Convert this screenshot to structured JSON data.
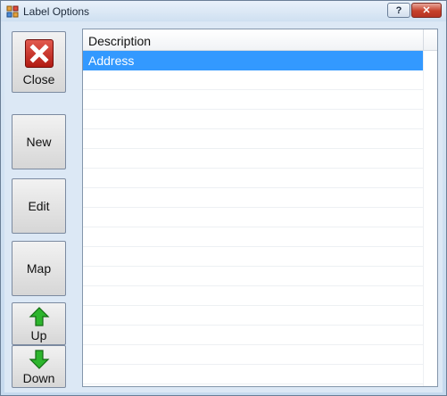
{
  "window": {
    "title": "Label Options",
    "help_symbol": "?",
    "close_symbol": "✕"
  },
  "toolbar": {
    "close_label": "Close",
    "new_label": "New",
    "edit_label": "Edit",
    "map_label": "Map",
    "up_label": "Up",
    "down_label": "Down"
  },
  "list": {
    "column_header": "Description",
    "rows": [
      "Address",
      "",
      "",
      "",
      "",
      "",
      "",
      "",
      "",
      "",
      "",
      "",
      "",
      "",
      "",
      "",
      ""
    ],
    "selected_index": 0
  },
  "colors": {
    "selection": "#3399ff",
    "close_icon_red": "#c62a1f",
    "arrow_green": "#2db52d"
  },
  "icons": [
    "app-icon",
    "close-x-icon",
    "up-arrow-icon",
    "down-arrow-icon"
  ]
}
